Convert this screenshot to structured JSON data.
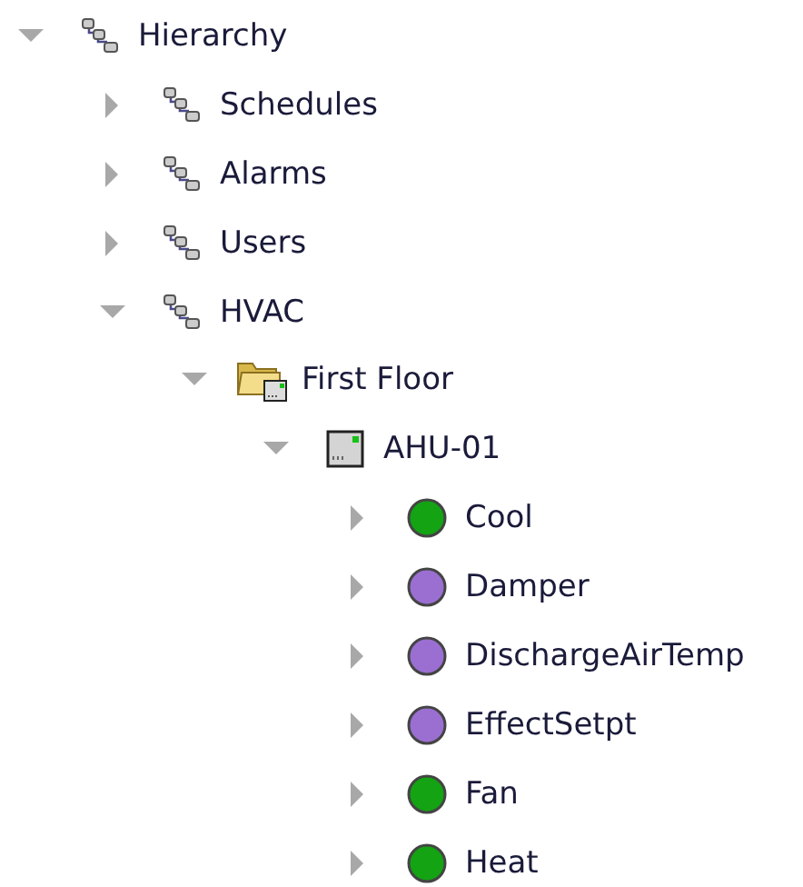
{
  "tree": [
    {
      "label": "Hierarchy",
      "kind": "hierarchy",
      "expanded": true,
      "children": [
        {
          "label": "Schedules",
          "kind": "hierarchy",
          "expanded": false
        },
        {
          "label": "Alarms",
          "kind": "hierarchy",
          "expanded": false
        },
        {
          "label": "Users",
          "kind": "hierarchy",
          "expanded": false
        },
        {
          "label": "HVAC",
          "kind": "hierarchy",
          "expanded": true,
          "children": [
            {
              "label": "First Floor",
              "kind": "folder",
              "expanded": true,
              "children": [
                {
                  "label": "AHU-01",
                  "kind": "device",
                  "expanded": true,
                  "children": [
                    {
                      "label": "Cool",
                      "kind": "point",
                      "expanded": false,
                      "color": "#13a313"
                    },
                    {
                      "label": "Damper",
                      "kind": "point",
                      "expanded": false,
                      "color": "#9b6fd1"
                    },
                    {
                      "label": "DischargeAirTemp",
                      "kind": "point",
                      "expanded": false,
                      "color": "#9b6fd1"
                    },
                    {
                      "label": "EffectSetpt",
                      "kind": "point",
                      "expanded": false,
                      "color": "#9b6fd1"
                    },
                    {
                      "label": "Fan",
                      "kind": "point",
                      "expanded": false,
                      "color": "#13a313"
                    },
                    {
                      "label": "Heat",
                      "kind": "point",
                      "expanded": false,
                      "color": "#13a313"
                    }
                  ]
                }
              ]
            }
          ]
        }
      ]
    }
  ]
}
